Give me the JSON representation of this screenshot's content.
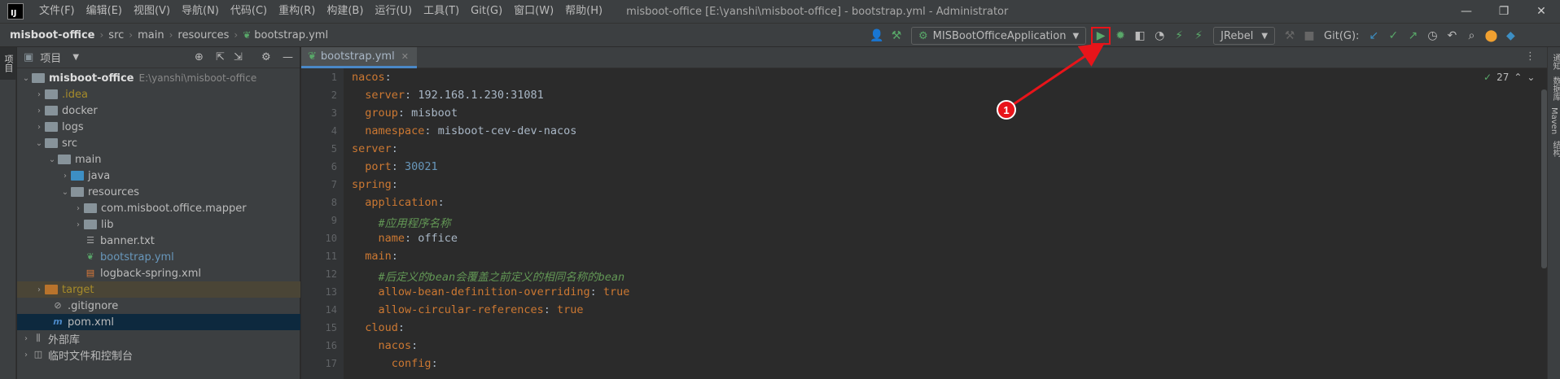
{
  "menu": [
    "文件(F)",
    "编辑(E)",
    "视图(V)",
    "导航(N)",
    "代码(C)",
    "重构(R)",
    "构建(B)",
    "运行(U)",
    "工具(T)",
    "Git(G)",
    "窗口(W)",
    "帮助(H)"
  ],
  "window_title": "misboot-office [E:\\yanshi\\misboot-office] - bootstrap.yml - Administrator",
  "breadcrumb": [
    "misboot-office",
    "src",
    "main",
    "resources",
    "bootstrap.yml"
  ],
  "toolbar": {
    "run_config": "MISBootOfficeApplication",
    "jrebel": "JRebel",
    "git_label": "Git(G):"
  },
  "left_tab": "项目",
  "project_panel": {
    "title": "项目"
  },
  "tree": [
    {
      "label": "misboot-office",
      "path": "E:\\yanshi\\misboot-office"
    },
    {
      "label": ".idea"
    },
    {
      "label": "docker"
    },
    {
      "label": "logs"
    },
    {
      "label": "src"
    },
    {
      "label": "main"
    },
    {
      "label": "java"
    },
    {
      "label": "resources"
    },
    {
      "label": "com.misboot.office.mapper"
    },
    {
      "label": "lib"
    },
    {
      "label": "banner.txt"
    },
    {
      "label": "bootstrap.yml"
    },
    {
      "label": "logback-spring.xml"
    },
    {
      "label": "target"
    },
    {
      "label": ".gitignore"
    },
    {
      "label": "pom.xml"
    },
    {
      "label": "外部库"
    },
    {
      "label": "临时文件和控制台"
    }
  ],
  "editor": {
    "tab": "bootstrap.yml",
    "inspection_count": "27",
    "lines": [
      "1",
      "2",
      "3",
      "4",
      "5",
      "6",
      "7",
      "8",
      "9",
      "10",
      "11",
      "12",
      "13",
      "14",
      "15",
      "16",
      "17"
    ]
  },
  "code": {
    "l1k": "nacos",
    "l2k": "server",
    "l2v": "192.168.1.230:31081",
    "l3k": "group",
    "l3v": "misboot",
    "l4k": "namespace",
    "l4v": "misboot-cev-dev-nacos",
    "l5k": "server",
    "l6k": "port",
    "l6v": "30021",
    "l7k": "spring",
    "l8k": "application",
    "l9c": "#应用程序名称",
    "l10k": "name",
    "l10v": "office",
    "l11k": "main",
    "l12c": "#后定义的bean会覆盖之前定义的相同名称的bean",
    "l13k": "allow-bean-definition-overriding",
    "l13v": "true",
    "l14k": "allow-circular-references",
    "l14v": "true",
    "l15k": "cloud",
    "l16k": "nacos",
    "l17k": "config"
  },
  "annotation": {
    "marker": "1",
    "color": "#e8141a"
  },
  "right_strip": [
    "通知",
    "数据库",
    "Maven",
    "结构"
  ],
  "colors": {
    "accent": "#4a88c7",
    "keyword": "#cc7832",
    "string": "#6a8759",
    "number": "#6897bb",
    "comment": "#629755",
    "run_green": "#59a869"
  }
}
